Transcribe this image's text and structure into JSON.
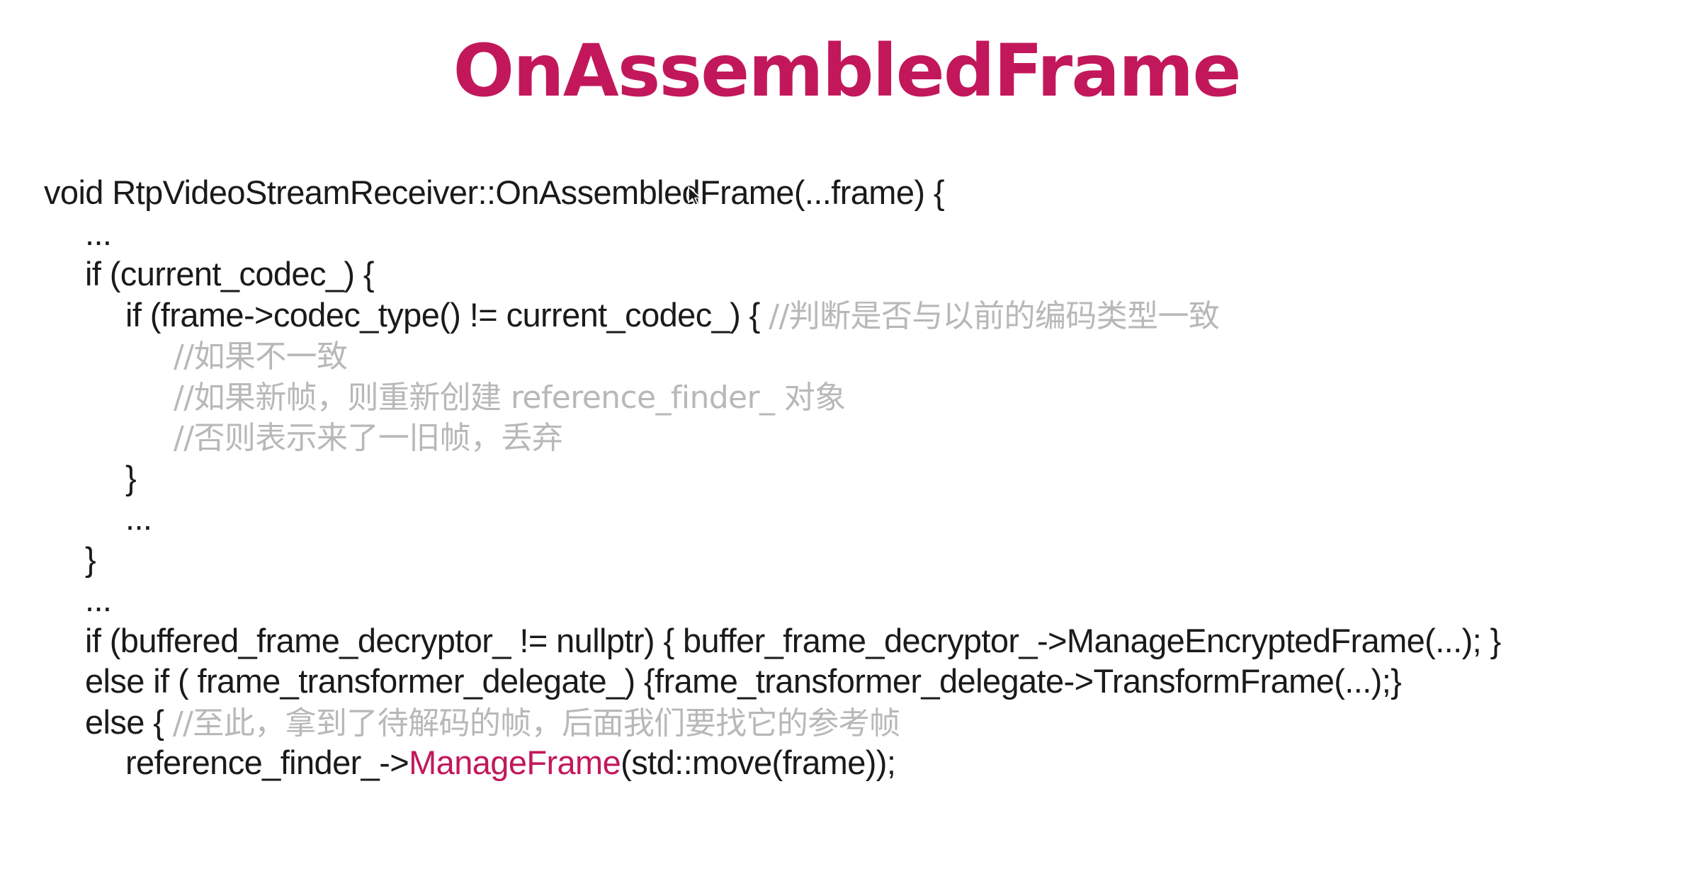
{
  "slide": {
    "title": "OnAssembledFrame"
  },
  "code": {
    "l01": "void RtpVideoStreamReceiver::OnAssembledFrame(...frame) {",
    "l02": "...",
    "l03": "if (current_codec_) {",
    "l04_code": "if (frame->codec_type() != current_codec_) { ",
    "l04_comment": "//判断是否与以前的编码类型一致",
    "l05_comment": "//如果不一致",
    "l06_comment": "//如果新帧，则重新创建 reference_finder_ 对象",
    "l07_comment": "//否则表示来了一旧帧，丢弃",
    "l08": "}",
    "l09": "...",
    "l10": "}",
    "l11": "...",
    "l12": "if (buffered_frame_decryptor_ != nullptr) { buffer_frame_decryptor_->ManageEncryptedFrame(...); }",
    "l13": "else if ( frame_transformer_delegate_) {frame_transformer_delegate->TransformFrame(...);}",
    "l14_code": "else { ",
    "l14_comment": "//至此，拿到了待解码的帧，后面我们要找它的参考帧",
    "l15_pre": "reference_finder_->",
    "l15_highlight": "ManageFrame",
    "l15_post": "(std::move(frame));"
  },
  "colors": {
    "title": "#c2185b",
    "code": "#1a1a1a",
    "comment": "#b8b8b8",
    "highlight": "#c2185b",
    "background": "#ffffff"
  },
  "icons": {
    "cursor": "mouse-cursor-icon"
  }
}
